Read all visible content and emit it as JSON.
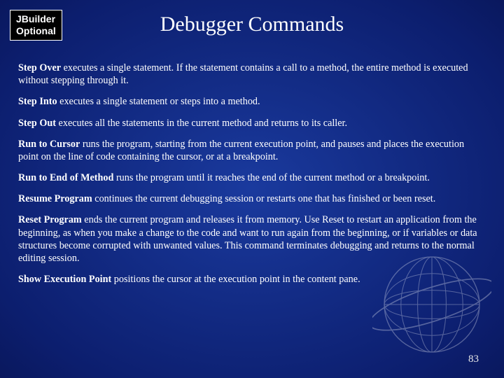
{
  "badge": {
    "line1": "JBuilder",
    "line2": "Optional"
  },
  "title": "Debugger Commands",
  "items": [
    {
      "term": "Step Over",
      "desc": " executes a single statement. If the statement contains a call to a method, the entire method is executed without stepping through it."
    },
    {
      "term": "Step Into",
      "desc": " executes a single statement or steps into a method."
    },
    {
      "term": "Step Out",
      "desc": " executes all the statements in the current method and returns to its caller."
    },
    {
      "term": "Run to Cursor",
      "desc": " runs the program, starting from the current execution point, and pauses and places the execution point on the line of code containing the cursor, or at a breakpoint."
    },
    {
      "term": "Run to End of Method",
      "desc": " runs the program until it reaches the end of the current method or a breakpoint."
    },
    {
      "term": "Resume Program",
      "desc": " continues the current debugging session or restarts one that has finished or been reset."
    },
    {
      "term": "Reset Program",
      "desc": " ends the current program and releases it from memory. Use Reset to restart an application from the beginning, as when you make a change to the code and want to run again from the beginning, or if variables or data structures become corrupted with unwanted values. This command terminates debugging and returns to the normal editing session."
    },
    {
      "term": "Show Execution Point",
      "desc": " positions the cursor at the execution point in the content pane."
    }
  ],
  "pageNumber": "83"
}
